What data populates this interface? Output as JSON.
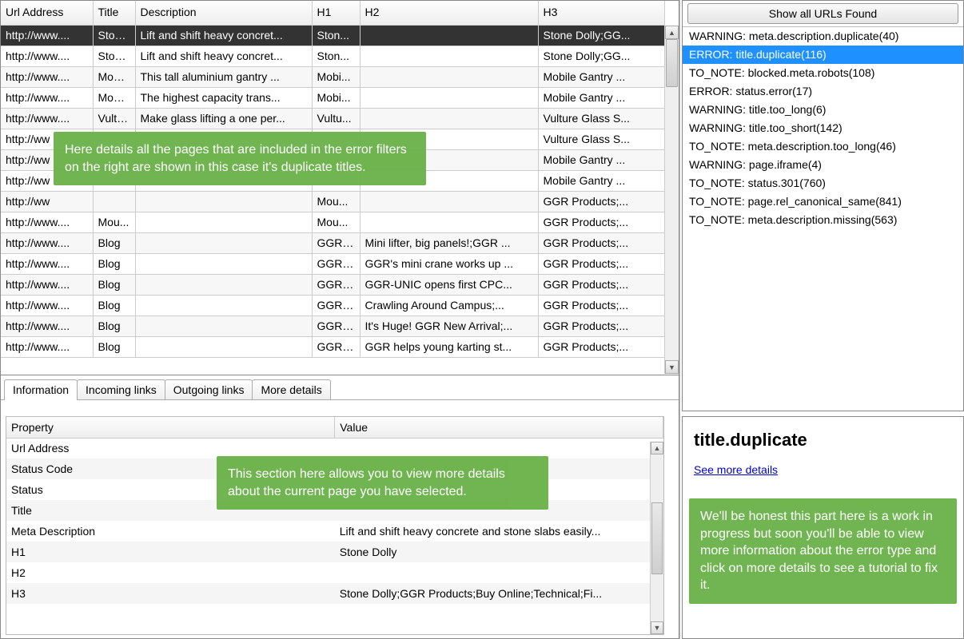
{
  "main_table": {
    "headers": [
      "Url Address",
      "Title",
      "Description",
      "H1",
      "H2",
      "H3"
    ],
    "rows": [
      {
        "url": "http://www....",
        "title": "Ston...",
        "desc": "Lift and shift heavy concret...",
        "h1": "Ston...",
        "h2": "",
        "h3": "Stone Dolly;GG...",
        "selected": true
      },
      {
        "url": "http://www....",
        "title": "Ston...",
        "desc": "Lift and shift heavy concret...",
        "h1": "Ston...",
        "h2": "",
        "h3": "Stone Dolly;GG..."
      },
      {
        "url": "http://www....",
        "title": "Mobi...",
        "desc": "This tall aluminium gantry ...",
        "h1": "Mobi...",
        "h2": "",
        "h3": "Mobile Gantry ..."
      },
      {
        "url": "http://www....",
        "title": "Mobi...",
        "desc": "The highest capacity trans...",
        "h1": "Mobi...",
        "h2": "",
        "h3": "Mobile Gantry ..."
      },
      {
        "url": "http://www....",
        "title": "Vultu...",
        "desc": "Make glass lifting a one per...",
        "h1": "Vultu...",
        "h2": "",
        "h3": "Vulture Glass S..."
      },
      {
        "url": "http://ww",
        "title": "",
        "desc": "",
        "h1": "",
        "h2": "",
        "h3": "Vulture Glass S..."
      },
      {
        "url": "http://ww",
        "title": "",
        "desc": "",
        "h1": "",
        "h2": "",
        "h3": "Mobile Gantry ..."
      },
      {
        "url": "http://ww",
        "title": "",
        "desc": "",
        "h1": "",
        "h2": "",
        "h3": "Mobile Gantry ..."
      },
      {
        "url": "http://ww",
        "title": "",
        "desc": "",
        "h1": "Mou...",
        "h2": "",
        "h3": "GGR Products;..."
      },
      {
        "url": "http://www....",
        "title": "Mou...",
        "desc": "",
        "h1": "Mou...",
        "h2": "",
        "h3": "GGR Products;..."
      },
      {
        "url": "http://www....",
        "title": "Blog",
        "desc": "",
        "h1": "GGR ...",
        "h2": "Mini lifter, big panels!;GGR ...",
        "h3": "GGR Products;..."
      },
      {
        "url": "http://www....",
        "title": "Blog",
        "desc": "",
        "h1": "GGR ...",
        "h2": "GGR's mini crane works up ...",
        "h3": "GGR Products;..."
      },
      {
        "url": "http://www....",
        "title": "Blog",
        "desc": "",
        "h1": "GGR ...",
        "h2": "GGR-UNIC opens first CPC...",
        "h3": "GGR Products;..."
      },
      {
        "url": "http://www....",
        "title": "Blog",
        "desc": "",
        "h1": "GGR ...",
        "h2": "Crawling Around Campus;...",
        "h3": "GGR Products;..."
      },
      {
        "url": "http://www....",
        "title": "Blog",
        "desc": "",
        "h1": "GGR ...",
        "h2": "It's Huge! GGR New Arrival;...",
        "h3": "GGR Products;..."
      },
      {
        "url": "http://www....",
        "title": "Blog",
        "desc": "",
        "h1": "GGR ...",
        "h2": "GGR helps young karting st...",
        "h3": "GGR Products;..."
      }
    ]
  },
  "tabs": [
    "Information",
    "Incoming links",
    "Outgoing links",
    "More details"
  ],
  "properties": {
    "headers": [
      "Property",
      "Value"
    ],
    "rows": [
      {
        "prop": "Url Address",
        "val": ""
      },
      {
        "prop": "Status Code",
        "val": ""
      },
      {
        "prop": "Status",
        "val": ""
      },
      {
        "prop": "Title",
        "val": ""
      },
      {
        "prop": "Meta Description",
        "val": "Lift and shift heavy concrete and stone slabs easily..."
      },
      {
        "prop": "H1",
        "val": "Stone Dolly"
      },
      {
        "prop": "H2",
        "val": ""
      },
      {
        "prop": "H3",
        "val": "Stone Dolly;GGR Products;Buy Online;Technical;Fi..."
      }
    ]
  },
  "right": {
    "button": "Show all URLs Found",
    "filters": [
      {
        "text": "WARNING: meta.description.duplicate(40)"
      },
      {
        "text": "ERROR: title.duplicate(116)",
        "selected": true
      },
      {
        "text": "TO_NOTE: blocked.meta.robots(108)"
      },
      {
        "text": "ERROR: status.error(17)"
      },
      {
        "text": "WARNING: title.too_long(6)"
      },
      {
        "text": "WARNING: title.too_short(142)"
      },
      {
        "text": "TO_NOTE: meta.description.too_long(46)"
      },
      {
        "text": "WARNING: page.iframe(4)"
      },
      {
        "text": "TO_NOTE: status.301(760)"
      },
      {
        "text": "TO_NOTE: page.rel_canonical_same(841)"
      },
      {
        "text": "TO_NOTE: meta.description.missing(563)"
      }
    ],
    "detail_title": "title.duplicate",
    "detail_link": "See more details"
  },
  "callouts": {
    "c1": "Here details all the pages that are included in the error filters on the right are shown in this case it's duplicate titles.",
    "c2": "This section here allows you to view more details about the current page you have selected.",
    "c3": "We'll be honest this part here is a work in progress but soon you'll be able to view more information about the error type and click on more details to see a tutorial to fix it."
  }
}
